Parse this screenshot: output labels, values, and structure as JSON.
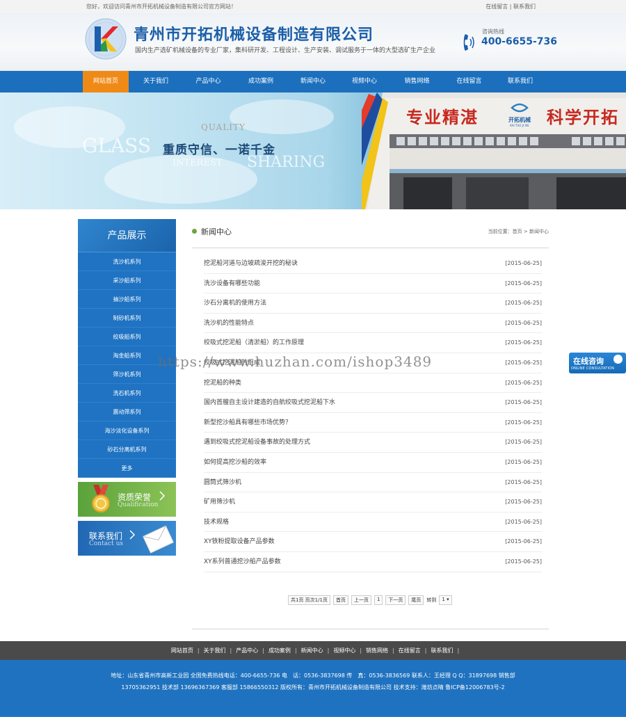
{
  "topbar": {
    "welcome": "您好，欢迎访问青州市开拓机械设备制造有限公司官方网站！",
    "favorite": "在线留言",
    "separator": "|",
    "contact": "联系我们"
  },
  "header": {
    "company_name": "青州市开拓机械设备制造有限公司",
    "slogan": "国内生产选矿机械设备的专业厂家，集科研开发、工程设计、生产安装、调试服务于一体的大型选矿生产企业",
    "hotline_label": "咨询热线",
    "hotline_number": "400-6655-736"
  },
  "nav": {
    "items": [
      {
        "label": "网站首页"
      },
      {
        "label": "关于我们"
      },
      {
        "label": "产品中心"
      },
      {
        "label": "成功案例"
      },
      {
        "label": "新闻中心"
      },
      {
        "label": "视频中心"
      },
      {
        "label": "销售网络"
      },
      {
        "label": "在线留言"
      },
      {
        "label": "联系我们"
      }
    ]
  },
  "banner": {
    "quality": "QUALITY",
    "glass": "GLASS",
    "interest": "INTEREST",
    "sharing": "SHARING",
    "slogan": "重质守信、一诺千金",
    "sign_left": "专业精湛",
    "sign_right": "科学开拓",
    "sign_logo": "开拓机械",
    "sign_logo_sub": "KAI TUO JI XIE"
  },
  "sidebar": {
    "title": "产品展示",
    "items": [
      {
        "label": "洗沙机系列"
      },
      {
        "label": "采沙船系列"
      },
      {
        "label": "抽沙船系列"
      },
      {
        "label": "制砂机系列"
      },
      {
        "label": "绞吸船系列"
      },
      {
        "label": "淘金船系列"
      },
      {
        "label": "筛沙机系列"
      },
      {
        "label": "洗石机系列"
      },
      {
        "label": "震动筛系列"
      },
      {
        "label": "海沙淡化设备系列"
      },
      {
        "label": "砂石分离机系列"
      },
      {
        "label": "更多"
      }
    ],
    "card_qualification": {
      "title": "资质荣誉",
      "sub": "Qualification"
    },
    "card_contact": {
      "title": "联系我们",
      "sub": "Contact us"
    }
  },
  "main": {
    "section_title": "新闻中心",
    "breadcrumb": "当前位置：首页 > 新闻中心",
    "news": [
      {
        "title": "挖泥船河道与边坡疏浚开挖的秘诀",
        "date": "[2015-06-25]"
      },
      {
        "title": "洗沙设备有哪些功能",
        "date": "[2015-06-25]"
      },
      {
        "title": "沙石分离机的使用方法",
        "date": "[2015-06-25]"
      },
      {
        "title": "洗沙机的性能特点",
        "date": "[2015-06-25]"
      },
      {
        "title": "绞吸式挖泥船（清淤船）的工作原理",
        "date": "[2015-06-25]"
      },
      {
        "title": "绞吸式挖泥船的组成",
        "date": "[2015-06-25]"
      },
      {
        "title": "挖泥船的种类",
        "date": "[2015-06-25]"
      },
      {
        "title": "国内首艘自主设计建造的自航绞吸式挖泥船下水",
        "date": "[2015-06-25]"
      },
      {
        "title": "新型挖沙船具有哪些市场优势？",
        "date": "[2015-06-25]"
      },
      {
        "title": "遇到绞吸式挖泥船设备事故的处理方式",
        "date": "[2015-06-25]"
      },
      {
        "title": "如何提高挖沙船的效率",
        "date": "[2015-06-25]"
      },
      {
        "title": "圆筒式筛沙机",
        "date": "[2015-06-25]"
      },
      {
        "title": "矿用筛沙机",
        "date": "[2015-06-25]"
      },
      {
        "title": "技术规格",
        "date": "[2015-06-25]"
      },
      {
        "title": "XY铁粉提取设备产品参数",
        "date": "[2015-06-25]"
      },
      {
        "title": "XY系列普通挖沙船产品参数",
        "date": "[2015-06-25]"
      }
    ],
    "pager": {
      "summary": "共1页 页次1/1页",
      "first": "首页",
      "prev": "上一页",
      "current": "1",
      "next": "下一页",
      "last": "尾页",
      "goto_label": "转到",
      "goto_value": "1 ▾"
    }
  },
  "float_consult": {
    "title": "在线咨询",
    "sub": "ONLINE CONSULTATION"
  },
  "watermark": "https://www.huzhan.com/ishop3489",
  "footer_nav": [
    {
      "label": "网站首页"
    },
    {
      "label": "关于我们"
    },
    {
      "label": "产品中心"
    },
    {
      "label": "成功案例"
    },
    {
      "label": "新闻中心"
    },
    {
      "label": "视频中心"
    },
    {
      "label": "销售网络"
    },
    {
      "label": "在线留言"
    },
    {
      "label": "联系我们"
    }
  ],
  "footer": {
    "line1": "地址：山东省青州市高新工业园 全国免费热线电话：400-6655-736 电　话：0536-3837698 传　真：0536-3836569 联系人：王经理 Q Q：31897698 销售部",
    "line2": "13705362951 技术部 13696367369 客服部 15866550312 版权所有：青州市开拓机械设备制造有限公司 技术支持：潍坊点晴 鲁ICP备12006783号-2"
  },
  "colors": {
    "brand_blue": "#1b6fbd",
    "nav_active": "#f08a17",
    "accent_green": "#6aa63a"
  }
}
